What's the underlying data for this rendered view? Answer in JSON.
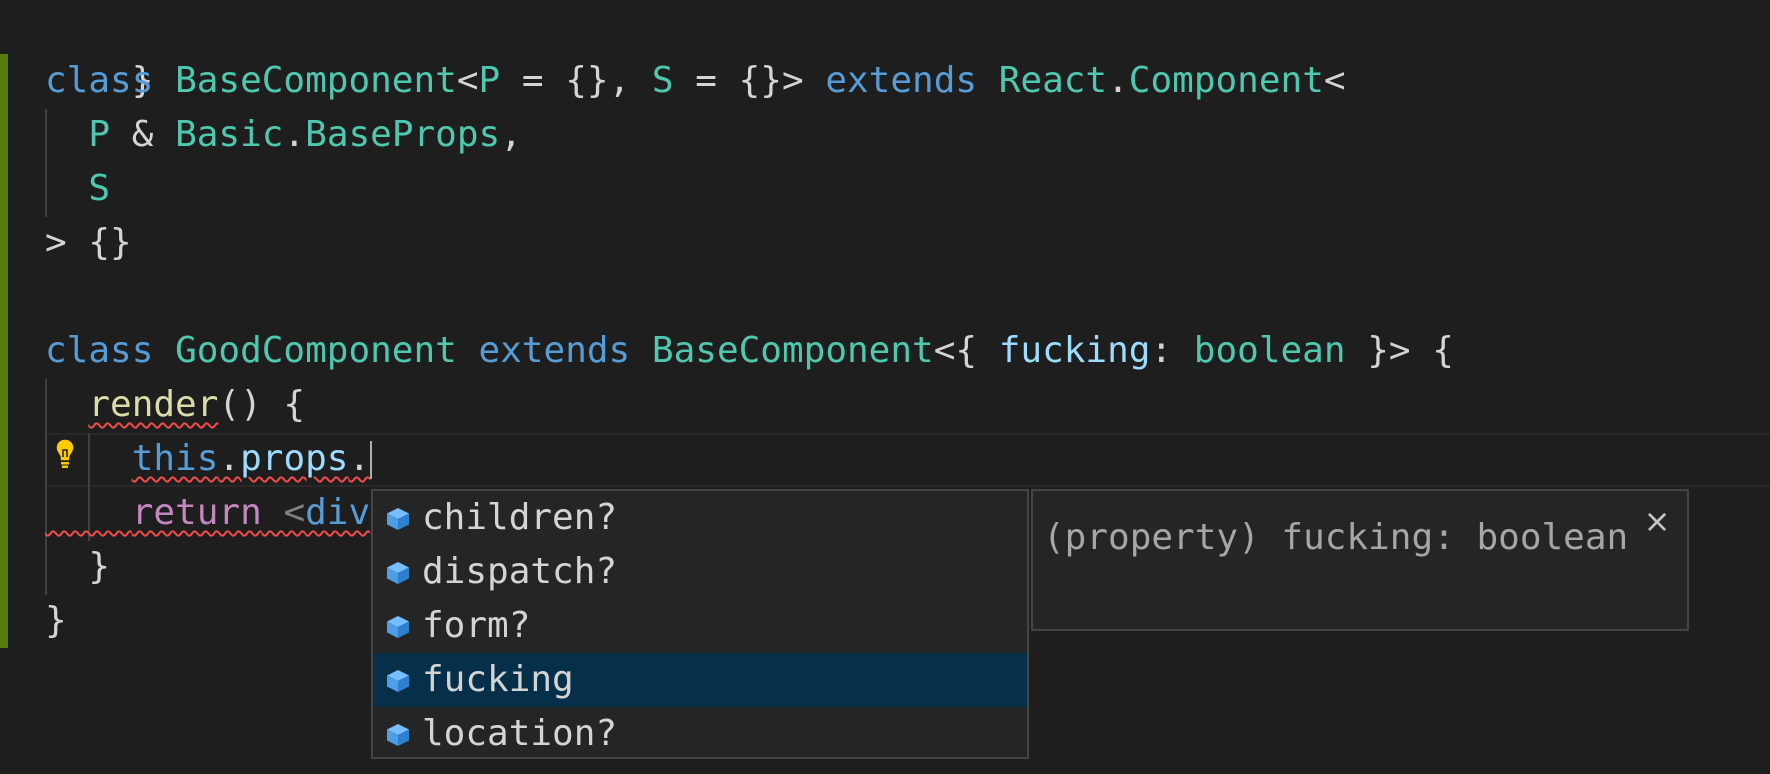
{
  "code": {
    "line1": {
      "brace": "}"
    },
    "line2": {
      "kw_class": "class",
      "name": "BaseComponent",
      "lt": "<",
      "p": "P",
      "eq1": " = {}, ",
      "s": "S",
      "eq2": " = {}> ",
      "kw_extends": "extends",
      "react": "React",
      "dot": ".",
      "component": "Component",
      "lt2": "<"
    },
    "line3": {
      "p": "P",
      "amp": " & ",
      "basic": "Basic",
      "dot": ".",
      "baseprops": "BaseProps",
      "comma": ","
    },
    "line4": {
      "s": "S"
    },
    "line5": {
      "text": "> {}"
    },
    "line7": {
      "kw_class": "class",
      "name": "GoodComponent",
      "kw_extends": "extends",
      "base": "BaseComponent",
      "open": "<{ ",
      "prop": "fucking",
      "colon": ": ",
      "type": "boolean",
      "close": " }> {"
    },
    "line8": {
      "fn": "render",
      "rest": "() {"
    },
    "line9": {
      "this": "this",
      "dot1": ".",
      "props": "props",
      "dot2": "."
    },
    "line10": {
      "kw_return": "return",
      "space": " ",
      "tag_open": "<",
      "tag": "div"
    },
    "line11": {
      "brace": "}"
    },
    "line12": {
      "brace": "}"
    }
  },
  "suggest": {
    "items": [
      {
        "label": "children?",
        "icon": "property-icon",
        "selected": false
      },
      {
        "label": "dispatch?",
        "icon": "property-icon",
        "selected": false
      },
      {
        "label": "form?",
        "icon": "property-icon",
        "selected": false
      },
      {
        "label": "fucking",
        "icon": "property-icon",
        "selected": true
      },
      {
        "label": "location?",
        "icon": "property-icon",
        "selected": false
      }
    ]
  },
  "details": {
    "text": "(property) fucking: boolean",
    "close_label": "×"
  },
  "colors": {
    "background": "#1e1e1e",
    "keyword": "#569cd6",
    "type": "#4ec9b0",
    "function": "#dcdcaa",
    "variable": "#9cdcfe",
    "control": "#c586c0",
    "selection": "#062f4a",
    "modified_gutter": "#587c0c",
    "error": "#f14c4c"
  }
}
